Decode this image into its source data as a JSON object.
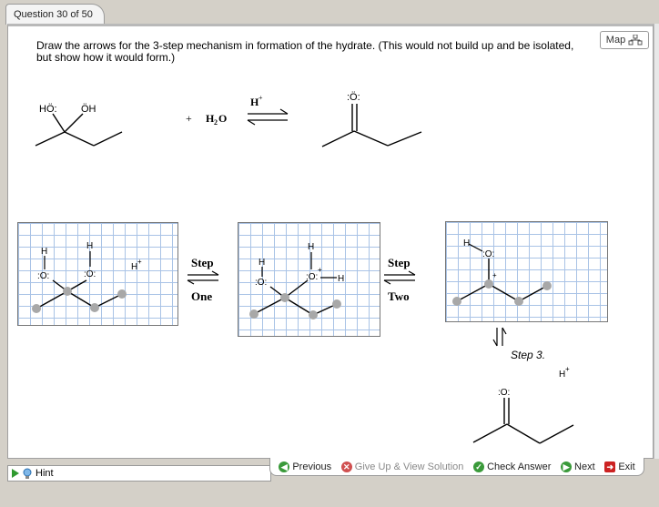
{
  "tab": {
    "label": "Question 30 of 50"
  },
  "map_button": {
    "label": "Map"
  },
  "question": {
    "text": "Draw the arrows for the 3-step mechanism in formation of the hydrate.  (This would not build up and be isolated, but show how it would form.)"
  },
  "reaction": {
    "plus": "+",
    "water_H": "H",
    "water_sub": "2",
    "water_O": "O",
    "catalyst": "H",
    "catalyst_charge": "+"
  },
  "steps": {
    "step1_top": "Step",
    "step1_bottom": "One",
    "step2_top": "Step",
    "step2_bottom": "Two",
    "step3": "Step 3."
  },
  "atoms": {
    "HO_left": "HÖ:",
    "OH_right": "ÖH",
    "carbonyl_O": ":Ö:",
    "H": "H",
    "O_lp": ":O:",
    "O_plus": "+",
    "H_plus": "H",
    "plus_sign": "+",
    "O_bottom": ":O:"
  },
  "nav": {
    "previous": "Previous",
    "give_up": "Give Up & View Solution",
    "check": "Check Answer",
    "next": "Next",
    "exit": "Exit"
  },
  "hint": {
    "label": "Hint"
  },
  "colors": {
    "grid_line": "#a9c3e6",
    "bond": "#000000",
    "atom_dot": "#a8a8a8",
    "accent_green": "#3a9a3a",
    "exit_red": "#cc2222"
  }
}
